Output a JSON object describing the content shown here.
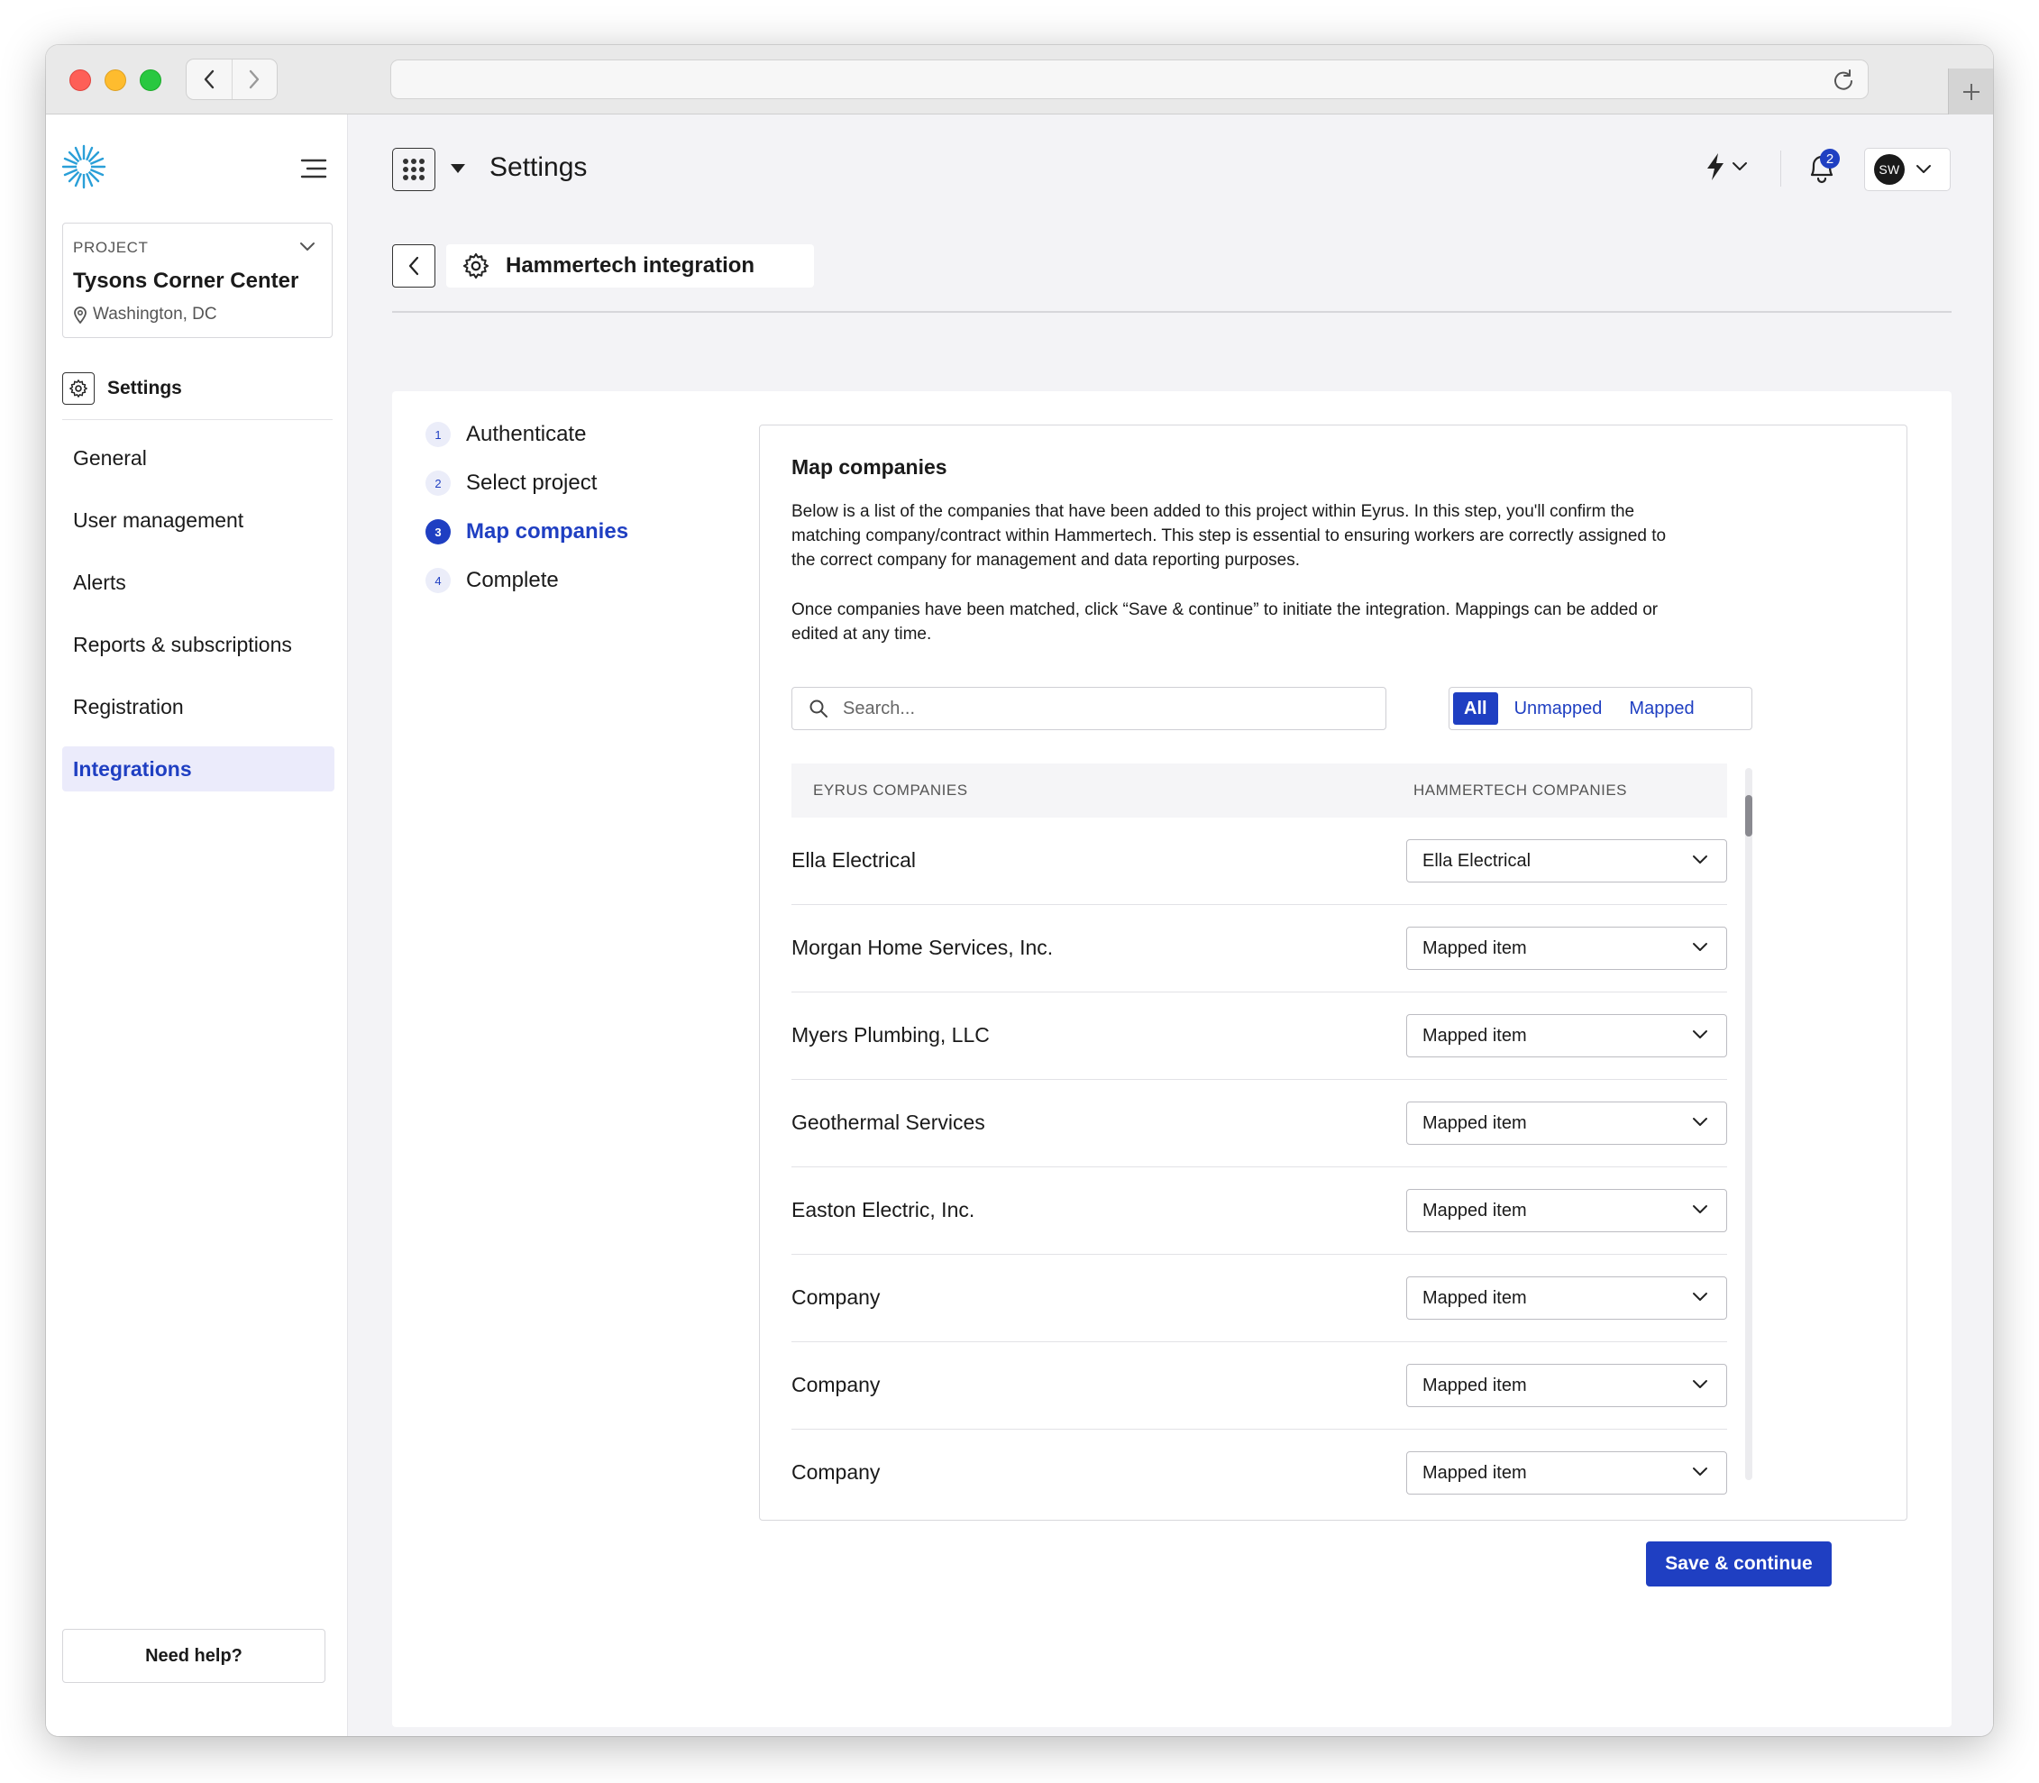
{
  "project": {
    "label": "PROJECT",
    "name": "Tysons Corner Center",
    "location": "Washington, DC"
  },
  "sidebar": {
    "section_title": "Settings",
    "items": [
      {
        "label": "General",
        "active": false
      },
      {
        "label": "User management",
        "active": false
      },
      {
        "label": "Alerts",
        "active": false
      },
      {
        "label": "Reports & subscriptions",
        "active": false
      },
      {
        "label": "Registration",
        "active": false
      },
      {
        "label": "Integrations",
        "active": true
      }
    ],
    "help_label": "Need help?"
  },
  "topbar": {
    "title": "Settings",
    "notification_count": "2",
    "user_initials": "SW"
  },
  "header": {
    "integration_title": "Hammertech integration"
  },
  "steps": [
    {
      "num": "1",
      "label": "Authenticate",
      "active": false
    },
    {
      "num": "2",
      "label": "Select project",
      "active": false
    },
    {
      "num": "3",
      "label": "Map companies",
      "active": true
    },
    {
      "num": "4",
      "label": "Complete",
      "active": false
    }
  ],
  "map": {
    "title": "Map companies",
    "description": "Below is a list of the companies that have been added to this project within Eyrus. In this step, you'll confirm the matching company/contract within Hammertech. This step is essential to ensuring workers are correctly assigned to the correct company for management and data reporting purposes.",
    "description2": "Once companies have been matched, click “Save & continue”  to initiate the integration. Mappings can be added or edited at any time.",
    "search_placeholder": "Search...",
    "filters": [
      "All",
      "Unmapped",
      "Mapped"
    ],
    "selected_filter": "All",
    "columns": [
      "EYRUS COMPANIES",
      "HAMMERTECH COMPANIES"
    ],
    "rows": [
      {
        "eyrus": "Ella Electrical",
        "hammertech": "Ella Electrical"
      },
      {
        "eyrus": "Morgan Home Services, Inc.",
        "hammertech": "Mapped item"
      },
      {
        "eyrus": "Myers Plumbing, LLC",
        "hammertech": "Mapped item"
      },
      {
        "eyrus": "Geothermal Services",
        "hammertech": "Mapped item"
      },
      {
        "eyrus": "Easton Electric, Inc.",
        "hammertech": "Mapped item"
      },
      {
        "eyrus": "Company",
        "hammertech": "Mapped item"
      },
      {
        "eyrus": "Company",
        "hammertech": "Mapped item"
      },
      {
        "eyrus": "Company",
        "hammertech": "Mapped item"
      }
    ],
    "save_label": "Save & continue"
  },
  "colors": {
    "accent": "#1f3fc2",
    "active_bg": "#ebebfb",
    "page_bg": "#f3f3f6"
  }
}
